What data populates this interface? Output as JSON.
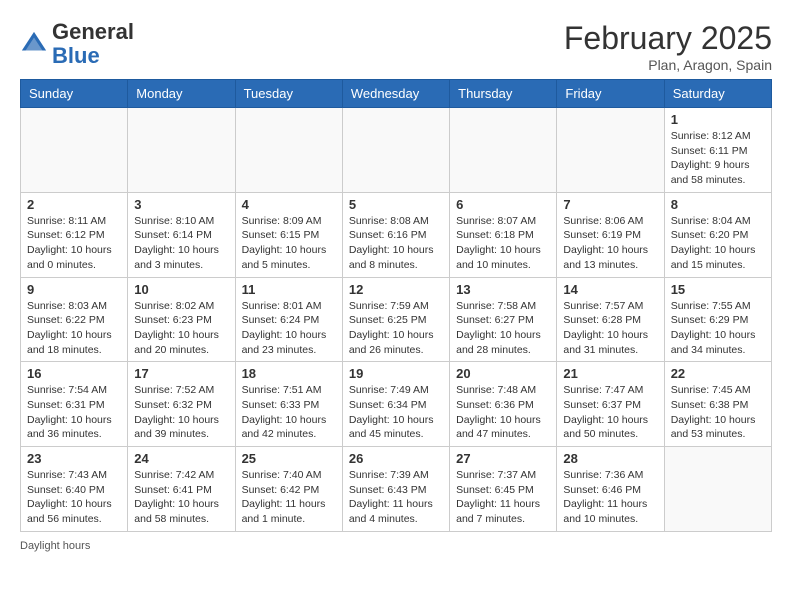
{
  "header": {
    "logo_general": "General",
    "logo_blue": "Blue",
    "month_year": "February 2025",
    "location": "Plan, Aragon, Spain"
  },
  "days_of_week": [
    "Sunday",
    "Monday",
    "Tuesday",
    "Wednesday",
    "Thursday",
    "Friday",
    "Saturday"
  ],
  "weeks": [
    [
      {
        "day": "",
        "info": ""
      },
      {
        "day": "",
        "info": ""
      },
      {
        "day": "",
        "info": ""
      },
      {
        "day": "",
        "info": ""
      },
      {
        "day": "",
        "info": ""
      },
      {
        "day": "",
        "info": ""
      },
      {
        "day": "1",
        "info": "Sunrise: 8:12 AM\nSunset: 6:11 PM\nDaylight: 9 hours and 58 minutes."
      }
    ],
    [
      {
        "day": "2",
        "info": "Sunrise: 8:11 AM\nSunset: 6:12 PM\nDaylight: 10 hours and 0 minutes."
      },
      {
        "day": "3",
        "info": "Sunrise: 8:10 AM\nSunset: 6:14 PM\nDaylight: 10 hours and 3 minutes."
      },
      {
        "day": "4",
        "info": "Sunrise: 8:09 AM\nSunset: 6:15 PM\nDaylight: 10 hours and 5 minutes."
      },
      {
        "day": "5",
        "info": "Sunrise: 8:08 AM\nSunset: 6:16 PM\nDaylight: 10 hours and 8 minutes."
      },
      {
        "day": "6",
        "info": "Sunrise: 8:07 AM\nSunset: 6:18 PM\nDaylight: 10 hours and 10 minutes."
      },
      {
        "day": "7",
        "info": "Sunrise: 8:06 AM\nSunset: 6:19 PM\nDaylight: 10 hours and 13 minutes."
      },
      {
        "day": "8",
        "info": "Sunrise: 8:04 AM\nSunset: 6:20 PM\nDaylight: 10 hours and 15 minutes."
      }
    ],
    [
      {
        "day": "9",
        "info": "Sunrise: 8:03 AM\nSunset: 6:22 PM\nDaylight: 10 hours and 18 minutes."
      },
      {
        "day": "10",
        "info": "Sunrise: 8:02 AM\nSunset: 6:23 PM\nDaylight: 10 hours and 20 minutes."
      },
      {
        "day": "11",
        "info": "Sunrise: 8:01 AM\nSunset: 6:24 PM\nDaylight: 10 hours and 23 minutes."
      },
      {
        "day": "12",
        "info": "Sunrise: 7:59 AM\nSunset: 6:25 PM\nDaylight: 10 hours and 26 minutes."
      },
      {
        "day": "13",
        "info": "Sunrise: 7:58 AM\nSunset: 6:27 PM\nDaylight: 10 hours and 28 minutes."
      },
      {
        "day": "14",
        "info": "Sunrise: 7:57 AM\nSunset: 6:28 PM\nDaylight: 10 hours and 31 minutes."
      },
      {
        "day": "15",
        "info": "Sunrise: 7:55 AM\nSunset: 6:29 PM\nDaylight: 10 hours and 34 minutes."
      }
    ],
    [
      {
        "day": "16",
        "info": "Sunrise: 7:54 AM\nSunset: 6:31 PM\nDaylight: 10 hours and 36 minutes."
      },
      {
        "day": "17",
        "info": "Sunrise: 7:52 AM\nSunset: 6:32 PM\nDaylight: 10 hours and 39 minutes."
      },
      {
        "day": "18",
        "info": "Sunrise: 7:51 AM\nSunset: 6:33 PM\nDaylight: 10 hours and 42 minutes."
      },
      {
        "day": "19",
        "info": "Sunrise: 7:49 AM\nSunset: 6:34 PM\nDaylight: 10 hours and 45 minutes."
      },
      {
        "day": "20",
        "info": "Sunrise: 7:48 AM\nSunset: 6:36 PM\nDaylight: 10 hours and 47 minutes."
      },
      {
        "day": "21",
        "info": "Sunrise: 7:47 AM\nSunset: 6:37 PM\nDaylight: 10 hours and 50 minutes."
      },
      {
        "day": "22",
        "info": "Sunrise: 7:45 AM\nSunset: 6:38 PM\nDaylight: 10 hours and 53 minutes."
      }
    ],
    [
      {
        "day": "23",
        "info": "Sunrise: 7:43 AM\nSunset: 6:40 PM\nDaylight: 10 hours and 56 minutes."
      },
      {
        "day": "24",
        "info": "Sunrise: 7:42 AM\nSunset: 6:41 PM\nDaylight: 10 hours and 58 minutes."
      },
      {
        "day": "25",
        "info": "Sunrise: 7:40 AM\nSunset: 6:42 PM\nDaylight: 11 hours and 1 minute."
      },
      {
        "day": "26",
        "info": "Sunrise: 7:39 AM\nSunset: 6:43 PM\nDaylight: 11 hours and 4 minutes."
      },
      {
        "day": "27",
        "info": "Sunrise: 7:37 AM\nSunset: 6:45 PM\nDaylight: 11 hours and 7 minutes."
      },
      {
        "day": "28",
        "info": "Sunrise: 7:36 AM\nSunset: 6:46 PM\nDaylight: 11 hours and 10 minutes."
      },
      {
        "day": "",
        "info": ""
      }
    ]
  ],
  "footer": "Daylight hours"
}
